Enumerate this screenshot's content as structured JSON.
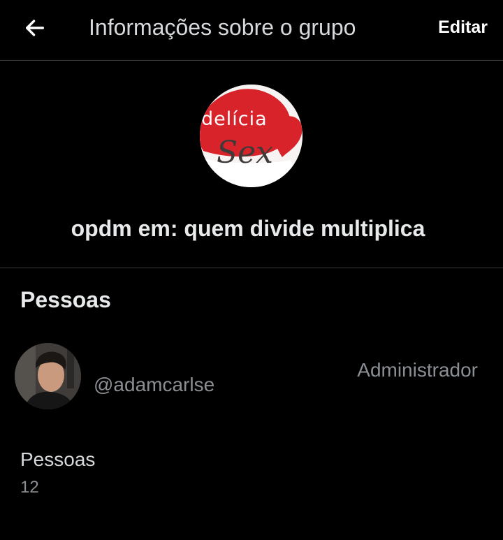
{
  "header": {
    "back_icon": "arrow-left-icon",
    "title": "Informações sobre o grupo",
    "edit_label": "Editar"
  },
  "group": {
    "avatar_text_top": "delícia",
    "avatar_text_bottom": "Sex",
    "name": "opdm em: quem divide multiplica"
  },
  "people_section": {
    "title": "Pessoas",
    "members": [
      {
        "handle": "@adamcarlse",
        "role": "Administrador"
      }
    ]
  },
  "people_count": {
    "label": "Pessoas",
    "value": "12"
  },
  "colors": {
    "background": "#000000",
    "text_primary": "#e7e9ea",
    "text_secondary": "#8b8f93",
    "divider": "#3a3c3f",
    "avatar_red": "#d9232a"
  }
}
